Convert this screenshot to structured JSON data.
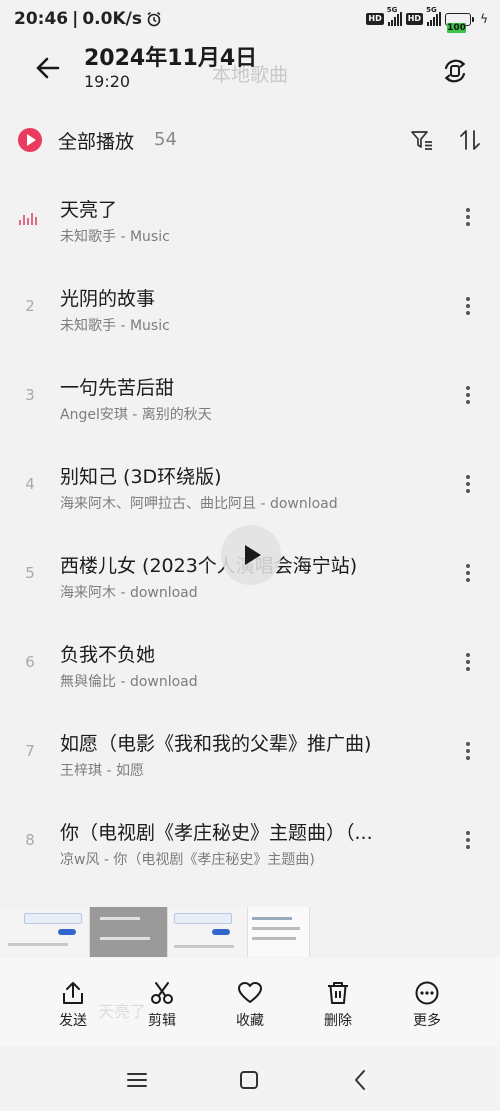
{
  "status_bar": {
    "time": "20:46",
    "net_speed": "0.0K/s",
    "hd_label": "HD",
    "network_type": "5G",
    "battery_level": "100"
  },
  "header": {
    "date": "2024年11月4日",
    "time": "19:20",
    "title": "本地歌曲"
  },
  "play_all": {
    "label": "全部播放",
    "count": "54"
  },
  "songs": [
    {
      "num": "",
      "title": "天亮了",
      "subtitle": "未知歌手 - Music",
      "playing": true
    },
    {
      "num": "2",
      "title": "光阴的故事",
      "subtitle": "未知歌手 - Music"
    },
    {
      "num": "3",
      "title": "一句先苦后甜",
      "subtitle": "Angel安琪 - 离别的秋天"
    },
    {
      "num": "4",
      "title": "别知己 (3D环绕版)",
      "subtitle": "海来阿木、阿呷拉古、曲比阿且 - download"
    },
    {
      "num": "5",
      "title": "西楼儿女 (2023个人演唱会海宁站)",
      "subtitle": "海来阿木 - download"
    },
    {
      "num": "6",
      "title": "负我不负她",
      "subtitle": "無與倫比 - download"
    },
    {
      "num": "7",
      "title": "如愿（电影《我和我的父辈》推广曲)",
      "subtitle": "王梓琪 - 如愿"
    },
    {
      "num": "8",
      "title": "你（电视剧《孝庄秘史》主题曲）（...",
      "subtitle": "凉w风 - 你（电视剧《孝庄秘史》主题曲)"
    }
  ],
  "ghost_text": "天亮了",
  "actions": [
    {
      "label": "发送",
      "icon": "share-icon"
    },
    {
      "label": "剪辑",
      "icon": "scissors-icon"
    },
    {
      "label": "收藏",
      "icon": "heart-icon"
    },
    {
      "label": "删除",
      "icon": "trash-icon"
    },
    {
      "label": "更多",
      "icon": "more-circle-icon"
    }
  ],
  "colors": {
    "accent": "#ea3a5e",
    "background": "#f2f2f2"
  }
}
